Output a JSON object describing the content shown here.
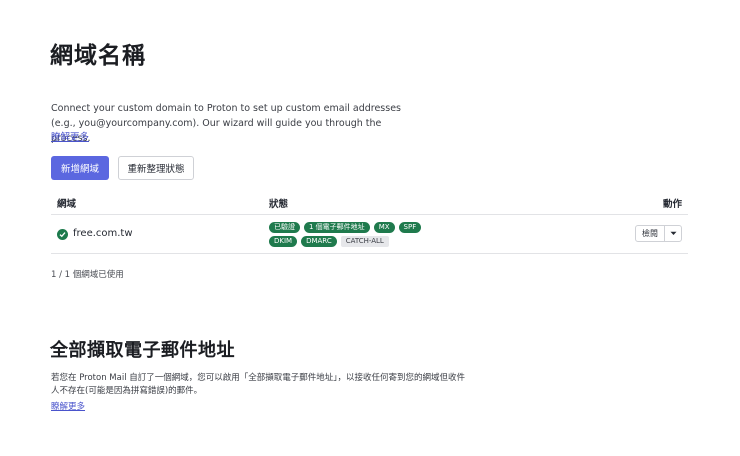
{
  "page": {
    "title": "網域名稱",
    "description": "Connect your custom domain to Proton to set up custom email addresses (e.g., you@yourcompany.com). Our wizard will guide you through the process.",
    "learn_more": "瞭解更多"
  },
  "actions": {
    "add_domain": "新增網域",
    "refresh_status": "重新整理狀態"
  },
  "table": {
    "headers": {
      "domain": "網域",
      "status": "狀態",
      "actions": "動作"
    },
    "rows": [
      {
        "domain": "free.com.tw",
        "verified": true,
        "badges_line1": [
          "已驗證",
          "1 個電子郵件地址",
          "MX",
          "SPF"
        ],
        "badges_line2": [
          "DKIM",
          "DMARC"
        ],
        "badge_inactive": "CATCH-ALL",
        "action_label": "檢閱"
      }
    ]
  },
  "usage": "1 / 1 個網域已使用",
  "catch_all": {
    "title": "全部擷取電子郵件地址",
    "description": "若您在 Proton Mail 自訂了一個網域，您可以啟用「全部擷取電子郵件地址」，以接收任何寄到您的網域但收件人不存在(可能是因為拼寫錯誤)的郵件。",
    "learn_more": "瞭解更多"
  },
  "colors": {
    "primary": "#5b67e0",
    "success": "#1f7a4d",
    "link": "#4a54cc"
  }
}
